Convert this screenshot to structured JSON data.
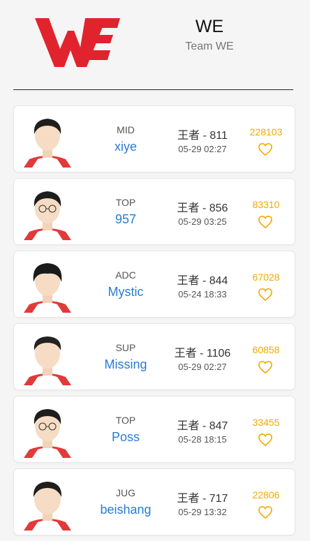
{
  "team": {
    "short": "WE",
    "full": "Team WE",
    "brand_color": "#e1232e"
  },
  "players": [
    {
      "role": "MID",
      "name": "xiye",
      "rank": "王者 - 811",
      "time": "05-29 02:27",
      "likes": "228103"
    },
    {
      "role": "TOP",
      "name": "957",
      "rank": "王者 - 856",
      "time": "05-29 03:25",
      "likes": "83310"
    },
    {
      "role": "ADC",
      "name": "Mystic",
      "rank": "王者 - 844",
      "time": "05-24 18:33",
      "likes": "67028"
    },
    {
      "role": "SUP",
      "name": "Missing",
      "rank": "王者 - 1106",
      "time": "05-29 02:27",
      "likes": "60858"
    },
    {
      "role": "TOP",
      "name": "Poss",
      "rank": "王者 - 847",
      "time": "05-28 18:15",
      "likes": "33455"
    },
    {
      "role": "JUG",
      "name": "beishang",
      "rank": "王者 - 717",
      "time": "05-29 13:32",
      "likes": "22806"
    }
  ],
  "icons": {
    "heart": "heart-outline-icon",
    "logo": "we-logo",
    "avatar": "player-photo"
  },
  "colors": {
    "name": "#2a7bd6",
    "likes": "#f2a900"
  }
}
